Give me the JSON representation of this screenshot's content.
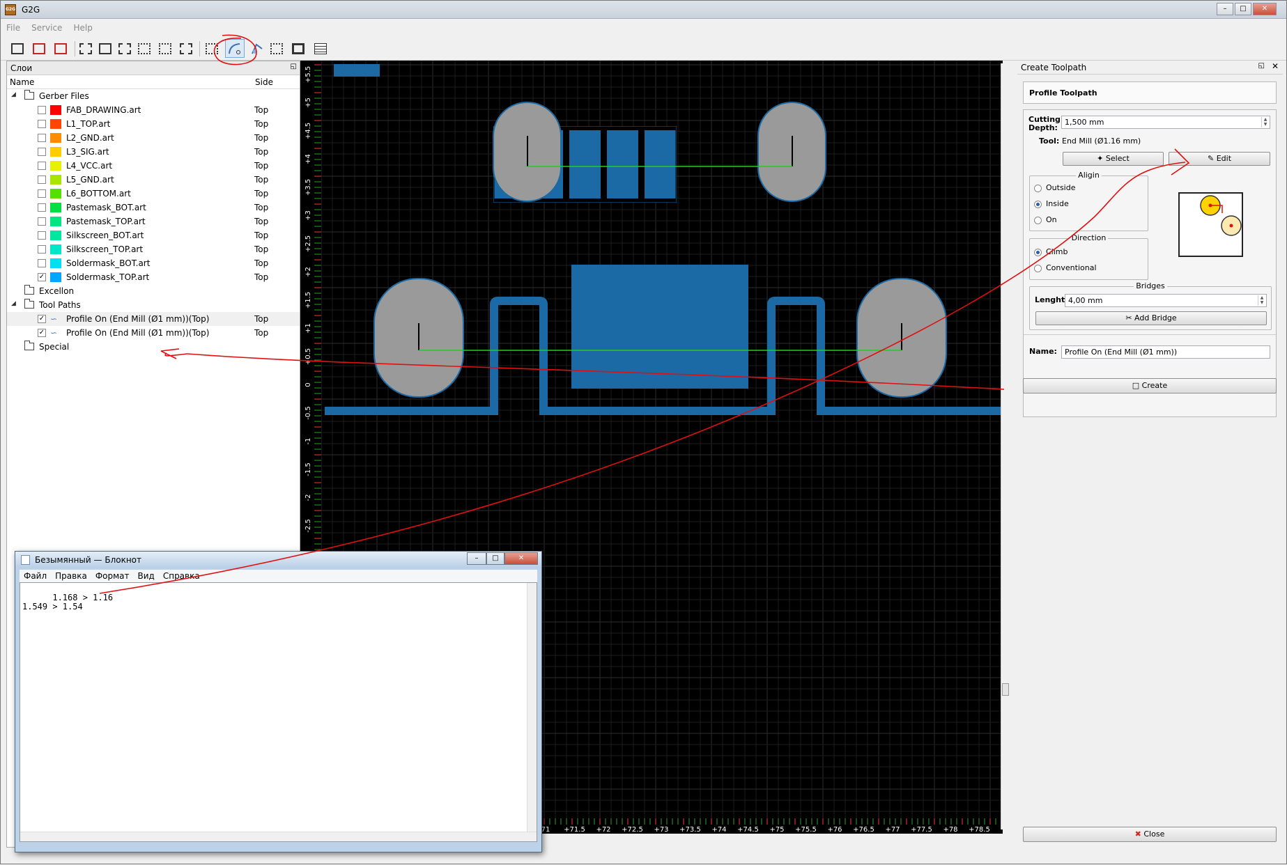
{
  "window": {
    "title": "G2G",
    "app_icon": "G2G"
  },
  "menu": [
    "File",
    "Service",
    "Help"
  ],
  "left_panel": {
    "title": "Слои",
    "col_name": "Name",
    "col_side": "Side",
    "groups": {
      "gerber": "Gerber Files",
      "excellon": "Excellon",
      "toolpaths": "Tool Paths",
      "special": "Special"
    },
    "layers": [
      {
        "name": "FAB_DRAWING.art",
        "side": "Top",
        "color": "#ff0000",
        "checked": false
      },
      {
        "name": "L1_TOP.art",
        "side": "Top",
        "color": "#ff4500",
        "checked": false
      },
      {
        "name": "L2_GND.art",
        "side": "Top",
        "color": "#ff8c00",
        "checked": false
      },
      {
        "name": "L3_SIG.art",
        "side": "Top",
        "color": "#ffcc00",
        "checked": false
      },
      {
        "name": "L4_VCC.art",
        "side": "Top",
        "color": "#e6f000",
        "checked": false
      },
      {
        "name": "L5_GND.art",
        "side": "Top",
        "color": "#a8e600",
        "checked": false
      },
      {
        "name": "L6_BOTTOM.art",
        "side": "Top",
        "color": "#55e000",
        "checked": false
      },
      {
        "name": "Pastemask_BOT.art",
        "side": "Top",
        "color": "#00e040",
        "checked": false
      },
      {
        "name": "Pastemask_TOP.art",
        "side": "Top",
        "color": "#00e680",
        "checked": false
      },
      {
        "name": "Silkscreen_BOT.art",
        "side": "Top",
        "color": "#00e6a0",
        "checked": false
      },
      {
        "name": "Silkscreen_TOP.art",
        "side": "Top",
        "color": "#00e6c8",
        "checked": false
      },
      {
        "name": "Soldermask_BOT.art",
        "side": "Top",
        "color": "#00e0f0",
        "checked": false
      },
      {
        "name": "Soldermask_TOP.art",
        "side": "Top",
        "color": "#00a6ff",
        "checked": true
      }
    ],
    "toolpaths": [
      {
        "name": "Profile On (End Mill (Ø1 mm))(Top)",
        "side": "Top",
        "checked": true
      },
      {
        "name": "Profile On (End Mill (Ø1 mm))(Top)",
        "side": "Top",
        "checked": true
      }
    ]
  },
  "canvas": {
    "background": "#000000",
    "copper_color": "#1b6aa5",
    "pad_color": "#9a9a9a",
    "toolpath_color": "#22cc22",
    "y_ticks": [
      "+5.5",
      "+5",
      "+4.5",
      "+4",
      "+3.5",
      "+3",
      "+2.5",
      "+2",
      "+1.5",
      "+1",
      "+0.5",
      "0",
      "-0.5",
      "-1",
      "-1.5",
      "-2",
      "-2.5"
    ],
    "x_ticks": [
      "71",
      "+71.5",
      "+72",
      "+72.5",
      "+73",
      "+73.5",
      "+74",
      "+74.5",
      "+75",
      "+75.5",
      "+76",
      "+76.5",
      "+77",
      "+77.5",
      "+78",
      "+78.5"
    ]
  },
  "right_panel": {
    "title": "Create Toolpath",
    "header": "Profile Toolpath",
    "cutting_depth_label": "Cutting Depth:",
    "cutting_depth_value": "1,500 mm",
    "tool_label": "Tool:",
    "tool_value": "End Mill (Ø1.16 mm)",
    "select_btn": "Select",
    "edit_btn": "Edit",
    "align_title": "Aligin",
    "align_options": [
      "Outside",
      "Inside",
      "On"
    ],
    "align_selected": "Inside",
    "direction_title": "Direction",
    "direction_options": [
      "Climb",
      "Conventional"
    ],
    "direction_selected": "Climb",
    "bridges_title": "Bridges",
    "length_label": "Lenght:",
    "length_value": "4,00 mm",
    "add_bridge_btn": "Add Bridge",
    "name_label": "Name:",
    "name_value": "Profile On (End Mill (Ø1 mm))",
    "create_btn": "Create",
    "close_btn": "Close"
  },
  "notepad": {
    "title": "Безымянный — Блокнот",
    "menu": [
      "Файл",
      "Правка",
      "Формат",
      "Вид",
      "Справка"
    ],
    "text": "1.168 > 1.16\n1.549 > 1.54"
  },
  "annotation_color": "#e01010"
}
